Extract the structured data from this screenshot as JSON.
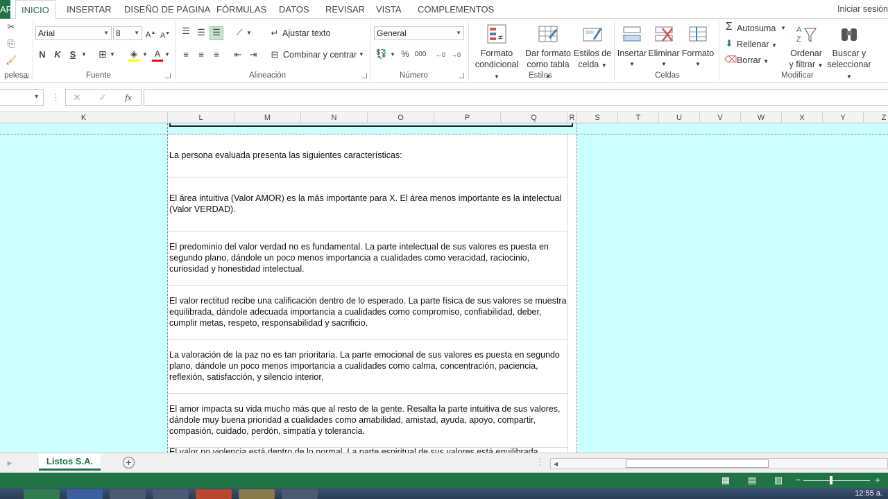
{
  "tabs": {
    "file": "ARCHIVO",
    "items": [
      "INICIO",
      "INSERTAR",
      "DISEÑO DE PÁGINA",
      "FÓRMULAS",
      "DATOS",
      "REVISAR",
      "VISTA",
      "COMPLEMENTOS"
    ],
    "active": "INICIO",
    "signin": "Iniciar sesión"
  },
  "ribbon": {
    "clipboard_label": "pelesa",
    "font_label": "Fuente",
    "font_name": "Arial",
    "font_size": "8",
    "bold": "N",
    "italic": "K",
    "underline": "S",
    "align_label": "Alineación",
    "wrap_text": "Ajustar texto",
    "merge_center": "Combinar y centrar",
    "number_label": "Número",
    "number_format": "General",
    "percent": "%",
    "thousands": "000",
    "styles_label": "Estilos",
    "cond_format": [
      "Formato",
      "condicional"
    ],
    "format_table": [
      "Dar formato",
      "como tabla"
    ],
    "cell_styles": [
      "Estilos de",
      "celda"
    ],
    "cells_label": "Celdas",
    "insert": "Insertar",
    "delete": "Eliminar",
    "format": "Formato",
    "modify_label": "Modificar",
    "autosum": "Autosuma",
    "fill": "Rellenar",
    "clear": "Borrar",
    "sort_filter": [
      "Ordenar",
      "y filtrar"
    ],
    "find_select": [
      "Buscar y",
      "seleccionar"
    ]
  },
  "formula_bar": {
    "cancel": "✕",
    "enter": "✓",
    "fx": "fx",
    "value": ""
  },
  "columns": [
    "K",
    "L",
    "M",
    "N",
    "O",
    "P",
    "Q",
    "R",
    "S",
    "T",
    "U",
    "V",
    "W",
    "X",
    "Y",
    "Z"
  ],
  "paragraphs": [
    "La persona evaluada presenta las siguientes características:",
    "El área intuitiva (Valor AMOR) es la más importante para X. El área menos importante es la intelectual (Valor VERDAD).",
    "El predominio del valor verdad no es fundamental. La parte intelectual de sus valores es puesta en segundo plano, dándole un poco menos importancia a cualidades como veracidad, raciocinio, curiosidad y honestidad intelectual.",
    "El valor rectitud recibe una calificación dentro de lo esperado. La parte física de sus valores se muestra equilibrada, dándole adecuada importancia a cualidades como compromiso, confiabilidad, deber, cumplir metas, respeto, responsabilidad y sacrificio.",
    "La valoración de la paz no es tan prioritaria. La parte emocional de sus valores es puesta en segundo plano, dándole un poco menos importancia a cualidades como calma, concentración, paciencia, reflexión, satisfacción, y silencio interior.",
    "El amor impacta su vida mucho más que al resto de la gente. Resalta la parte intuitiva de sus valores, dándole muy buena prioridad a cualidades como amabilidad, amistad, ayuda, apoyo, compartir, compasión, cuidado, perdón, simpatía y tolerancia.",
    "El valor no violencia está dentro de lo normal. La parte espiritual de sus valores está equilibrada"
  ],
  "sheet": {
    "name": "Listos S.A.",
    "add": "+"
  },
  "taskbar": {
    "clock": "12:55 a."
  },
  "colors": {
    "accent": "#217346",
    "grid_bg": "#ccffff"
  }
}
